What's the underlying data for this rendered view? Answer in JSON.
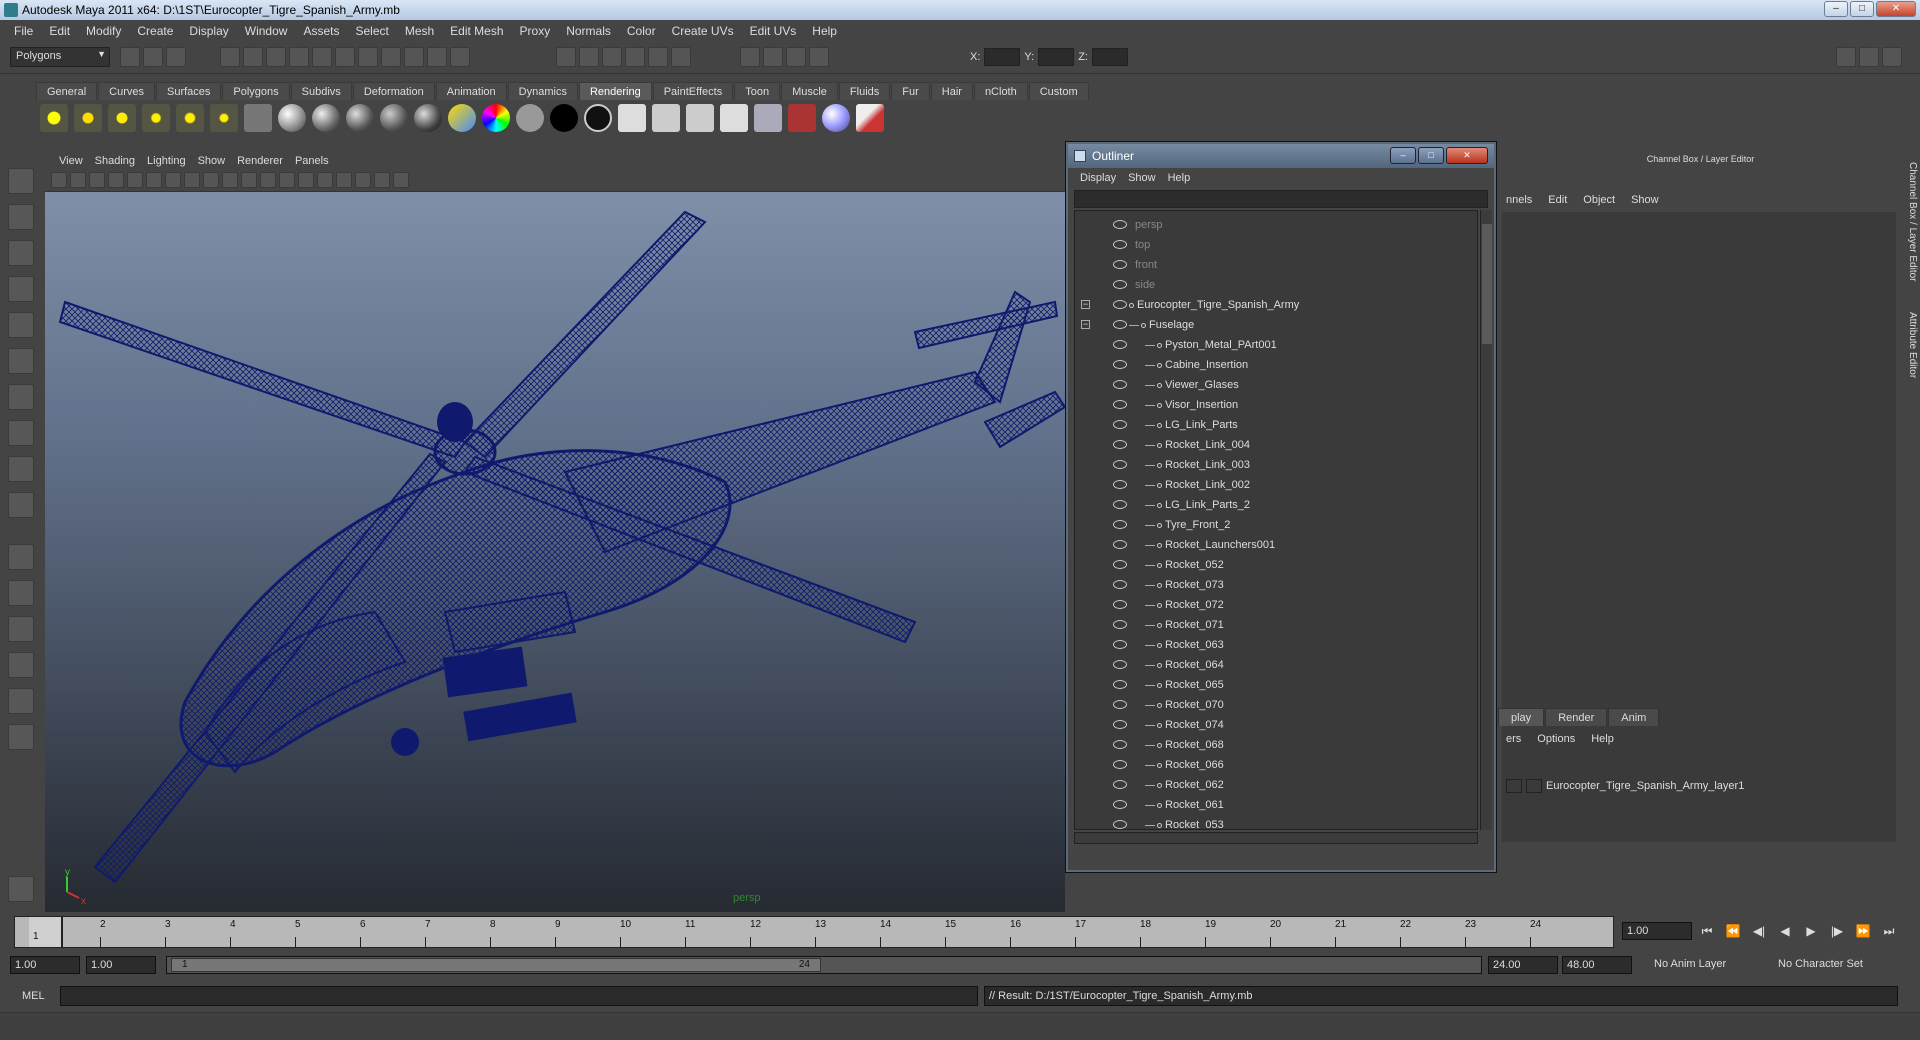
{
  "window": {
    "title": "Autodesk Maya 2011 x64: D:\\1ST\\Eurocopter_Tigre_Spanish_Army.mb",
    "btn_minimize": "–",
    "btn_maximize": "□",
    "btn_close": "✕"
  },
  "menubar": [
    "File",
    "Edit",
    "Modify",
    "Create",
    "Display",
    "Window",
    "Assets",
    "Select",
    "Mesh",
    "Edit Mesh",
    "Proxy",
    "Normals",
    "Color",
    "Create UVs",
    "Edit UVs",
    "Help"
  ],
  "statusline": {
    "mode": "Polygons",
    "x_label": "X:",
    "y_label": "Y:",
    "z_label": "Z:"
  },
  "shelf": {
    "tabs": [
      "General",
      "Curves",
      "Surfaces",
      "Polygons",
      "Subdivs",
      "Deformation",
      "Animation",
      "Dynamics",
      "Rendering",
      "PaintEffects",
      "Toon",
      "Muscle",
      "Fluids",
      "Fur",
      "Hair",
      "nCloth",
      "Custom"
    ],
    "active_tab": "Rendering"
  },
  "viewport": {
    "menu": [
      "View",
      "Shading",
      "Lighting",
      "Show",
      "Renderer",
      "Panels"
    ],
    "camera_label": "persp",
    "axis_y": "y",
    "axis_x": "x",
    "wire_color": "#0f1a6e"
  },
  "outliner": {
    "title": "Outliner",
    "menu": [
      "Display",
      "Show",
      "Help"
    ],
    "items": [
      {
        "label": "persp",
        "kind": "camera",
        "depth": 0
      },
      {
        "label": "top",
        "kind": "camera",
        "depth": 0
      },
      {
        "label": "front",
        "kind": "camera",
        "depth": 0
      },
      {
        "label": "side",
        "kind": "camera",
        "depth": 0
      },
      {
        "label": "Eurocopter_Tigre_Spanish_Army",
        "kind": "group",
        "depth": 0,
        "expanded": true
      },
      {
        "label": "Fuselage",
        "kind": "mesh",
        "depth": 1,
        "expanded": true
      },
      {
        "label": "Pyston_Metal_PArt001",
        "kind": "mesh",
        "depth": 2
      },
      {
        "label": "Cabine_Insertion",
        "kind": "mesh",
        "depth": 2
      },
      {
        "label": "Viewer_Glases",
        "kind": "mesh",
        "depth": 2
      },
      {
        "label": "Visor_Insertion",
        "kind": "mesh",
        "depth": 2
      },
      {
        "label": "LG_Link_Parts",
        "kind": "mesh",
        "depth": 2
      },
      {
        "label": "Rocket_Link_004",
        "kind": "mesh",
        "depth": 2
      },
      {
        "label": "Rocket_Link_003",
        "kind": "mesh",
        "depth": 2
      },
      {
        "label": "Rocket_Link_002",
        "kind": "mesh",
        "depth": 2
      },
      {
        "label": "LG_Link_Parts_2",
        "kind": "mesh",
        "depth": 2
      },
      {
        "label": "Tyre_Front_2",
        "kind": "mesh",
        "depth": 2
      },
      {
        "label": "Rocket_Launchers001",
        "kind": "mesh",
        "depth": 2
      },
      {
        "label": "Rocket_052",
        "kind": "mesh",
        "depth": 2
      },
      {
        "label": "Rocket_073",
        "kind": "mesh",
        "depth": 2
      },
      {
        "label": "Rocket_072",
        "kind": "mesh",
        "depth": 2
      },
      {
        "label": "Rocket_071",
        "kind": "mesh",
        "depth": 2
      },
      {
        "label": "Rocket_063",
        "kind": "mesh",
        "depth": 2
      },
      {
        "label": "Rocket_064",
        "kind": "mesh",
        "depth": 2
      },
      {
        "label": "Rocket_065",
        "kind": "mesh",
        "depth": 2
      },
      {
        "label": "Rocket_070",
        "kind": "mesh",
        "depth": 2
      },
      {
        "label": "Rocket_074",
        "kind": "mesh",
        "depth": 2
      },
      {
        "label": "Rocket_068",
        "kind": "mesh",
        "depth": 2
      },
      {
        "label": "Rocket_066",
        "kind": "mesh",
        "depth": 2
      },
      {
        "label": "Rocket_062",
        "kind": "mesh",
        "depth": 2
      },
      {
        "label": "Rocket_061",
        "kind": "mesh",
        "depth": 2
      },
      {
        "label": "Rocket_053",
        "kind": "mesh",
        "depth": 2
      }
    ]
  },
  "channelbox": {
    "title": "Channel Box / Layer Editor",
    "menu": [
      "nnels",
      "Edit",
      "Object",
      "Show"
    ],
    "layer_tabs": [
      "play",
      "Render",
      "Anim"
    ],
    "layer_menu": [
      "ers",
      "Options",
      "Help"
    ],
    "layer_name": "Eurocopter_Tigre_Spanish_Army_layer1",
    "side_tab_1": "Channel Box / Layer Editor",
    "side_tab_2": "Attribute Editor"
  },
  "timeline": {
    "ticks": [
      "1",
      "2",
      "3",
      "4",
      "5",
      "6",
      "7",
      "8",
      "9",
      "10",
      "11",
      "12",
      "13",
      "14",
      "15",
      "16",
      "17",
      "18",
      "19",
      "20",
      "21",
      "22",
      "23",
      "24"
    ],
    "current_frame_marker": "1",
    "current_frame": "1.00",
    "play_buttons": [
      "⏮",
      "⏪",
      "◀|",
      "◀",
      "▶",
      "|▶",
      "⏩",
      "⏭"
    ]
  },
  "range": {
    "start": "1.00",
    "anim_start": "1.00",
    "range_start": "1",
    "range_end": "24",
    "end": "24.00",
    "anim_end": "48.00",
    "anim_layer": "No Anim Layer",
    "character_set": "No Character Set"
  },
  "commandline": {
    "label": "MEL",
    "result": "// Result: D:/1ST/Eurocopter_Tigre_Spanish_Army.mb"
  }
}
